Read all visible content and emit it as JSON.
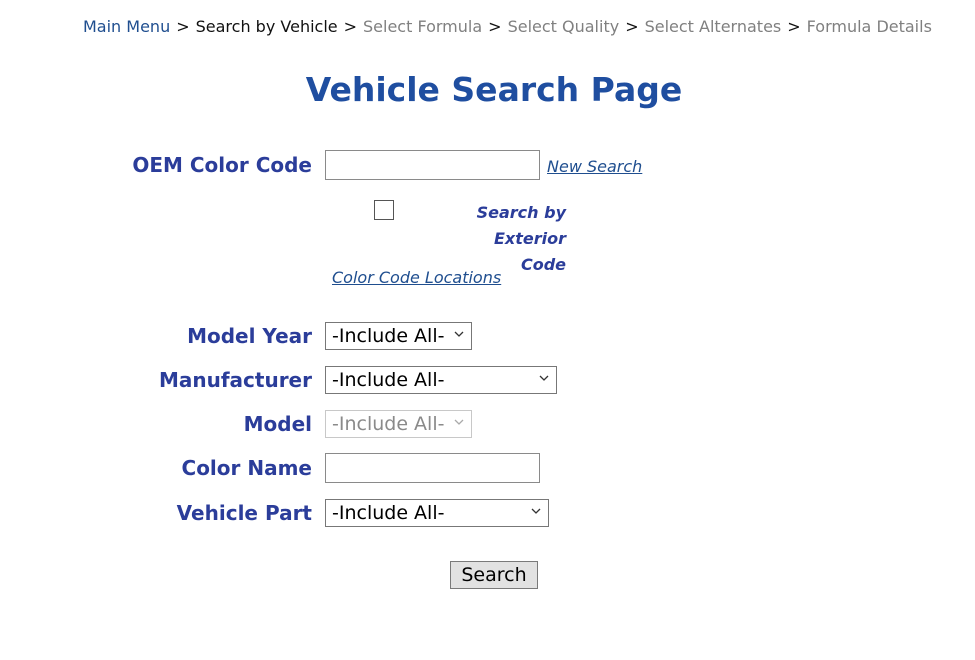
{
  "breadcrumb": {
    "items": [
      {
        "label": "Main Menu",
        "state": "link"
      },
      {
        "label": "Search by Vehicle",
        "state": "current"
      },
      {
        "label": "Select Formula",
        "state": "disabled"
      },
      {
        "label": "Select Quality",
        "state": "disabled"
      },
      {
        "label": "Select Alternates",
        "state": "disabled"
      },
      {
        "label": "Formula Details",
        "state": "disabled"
      }
    ],
    "separator": ">"
  },
  "title": "Vehicle Search Page",
  "form": {
    "oem_color_code": {
      "label": "OEM Color Code",
      "value": ""
    },
    "new_search_link": "New Search",
    "exterior_checkbox": {
      "label_line1": "Search by Exterior",
      "label_line2": "Code",
      "checked": false
    },
    "color_code_locations_link": "Color Code Locations",
    "model_year": {
      "label": "Model Year",
      "selected": "-Include All-"
    },
    "manufacturer": {
      "label": "Manufacturer",
      "selected": "-Include All-"
    },
    "model": {
      "label": "Model",
      "selected": "-Include All-",
      "disabled": true
    },
    "color_name": {
      "label": "Color Name",
      "value": ""
    },
    "vehicle_part": {
      "label": "Vehicle Part",
      "selected": "-Include All-"
    },
    "search_button": "Search"
  },
  "colors": {
    "title": "#1f4ea0",
    "label": "#2b3d9a",
    "link": "#1f4e8f",
    "disabled_text": "#808080"
  }
}
